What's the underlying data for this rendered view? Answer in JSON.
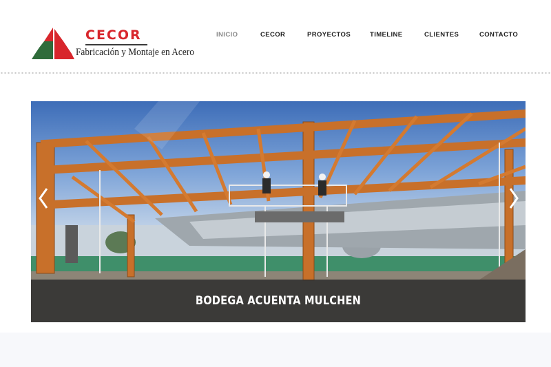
{
  "logo": {
    "title": "CECOR",
    "subtitle": "Fabricación y Montaje en Acero",
    "brand_color": "#d8262c",
    "mark_icon": "cecor-triangle-logo"
  },
  "nav": {
    "items": [
      {
        "label": "INICIO",
        "active": true
      },
      {
        "label": "CECOR",
        "active": false
      },
      {
        "label": "PROYECTOS",
        "active": false
      },
      {
        "label": "TIMELINE",
        "active": false
      },
      {
        "label": "CLIENTES",
        "active": false
      },
      {
        "label": "CONTACTO",
        "active": false
      }
    ]
  },
  "slider": {
    "caption": "BODEGA ACUENTA MULCHEN",
    "prev_icon": "chevron-left-icon",
    "next_icon": "chevron-right-icon",
    "image_subject": "steel-frame-construction-photo"
  },
  "colors": {
    "accent_red": "#d8262c",
    "steel_orange": "#c8702a",
    "caption_bg": "#303030"
  }
}
